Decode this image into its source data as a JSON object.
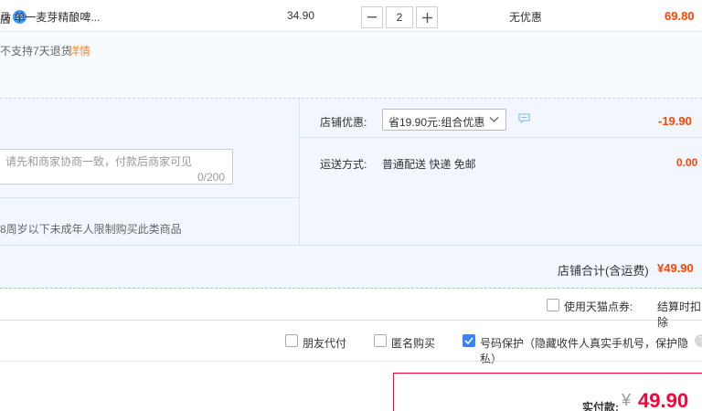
{
  "shop": {
    "name": "店"
  },
  "item": {
    "title": "马 单一麦芽精酿啤...",
    "price": "34.90",
    "quantity": "2",
    "discount": "无优惠",
    "subtotal": "69.80",
    "return_note": "不支持7天退货",
    "return_detail_link": "详情",
    "qty_minus": "—",
    "qty_plus": "+"
  },
  "message": {
    "placeholder": "请先和商家协商一致，付款后商家可见",
    "counter": "0/200"
  },
  "age_note": "8周岁以下未成年人限制购买此类商品",
  "store_promo": {
    "label": "店铺优惠:",
    "selected": "省19.90元:组合优惠",
    "amount": "-19.90"
  },
  "delivery": {
    "label": "运送方式:",
    "value": "普通配送 快递 免邮",
    "amount": "0.00"
  },
  "total": {
    "label": "店铺合计(含运费)",
    "amount": "¥49.90"
  },
  "points": {
    "label": "使用天猫点券:",
    "note": "结算时扣除"
  },
  "order_options": {
    "friend_pay": "朋友代付",
    "anonymous": "匿名购买",
    "privacy": "号码保护（隐藏收件人真实手机号，保护隐私）",
    "help": "?"
  },
  "payment": {
    "label": "实付款:",
    "currency": "¥",
    "amount": "49.90"
  },
  "colors": {
    "accent_red": "#ff0036",
    "price_orange": "#ff4400",
    "link_orange": "#f08b33",
    "checkbox_blue": "#3b82f6",
    "badge_blue": "#3a9bfd"
  }
}
